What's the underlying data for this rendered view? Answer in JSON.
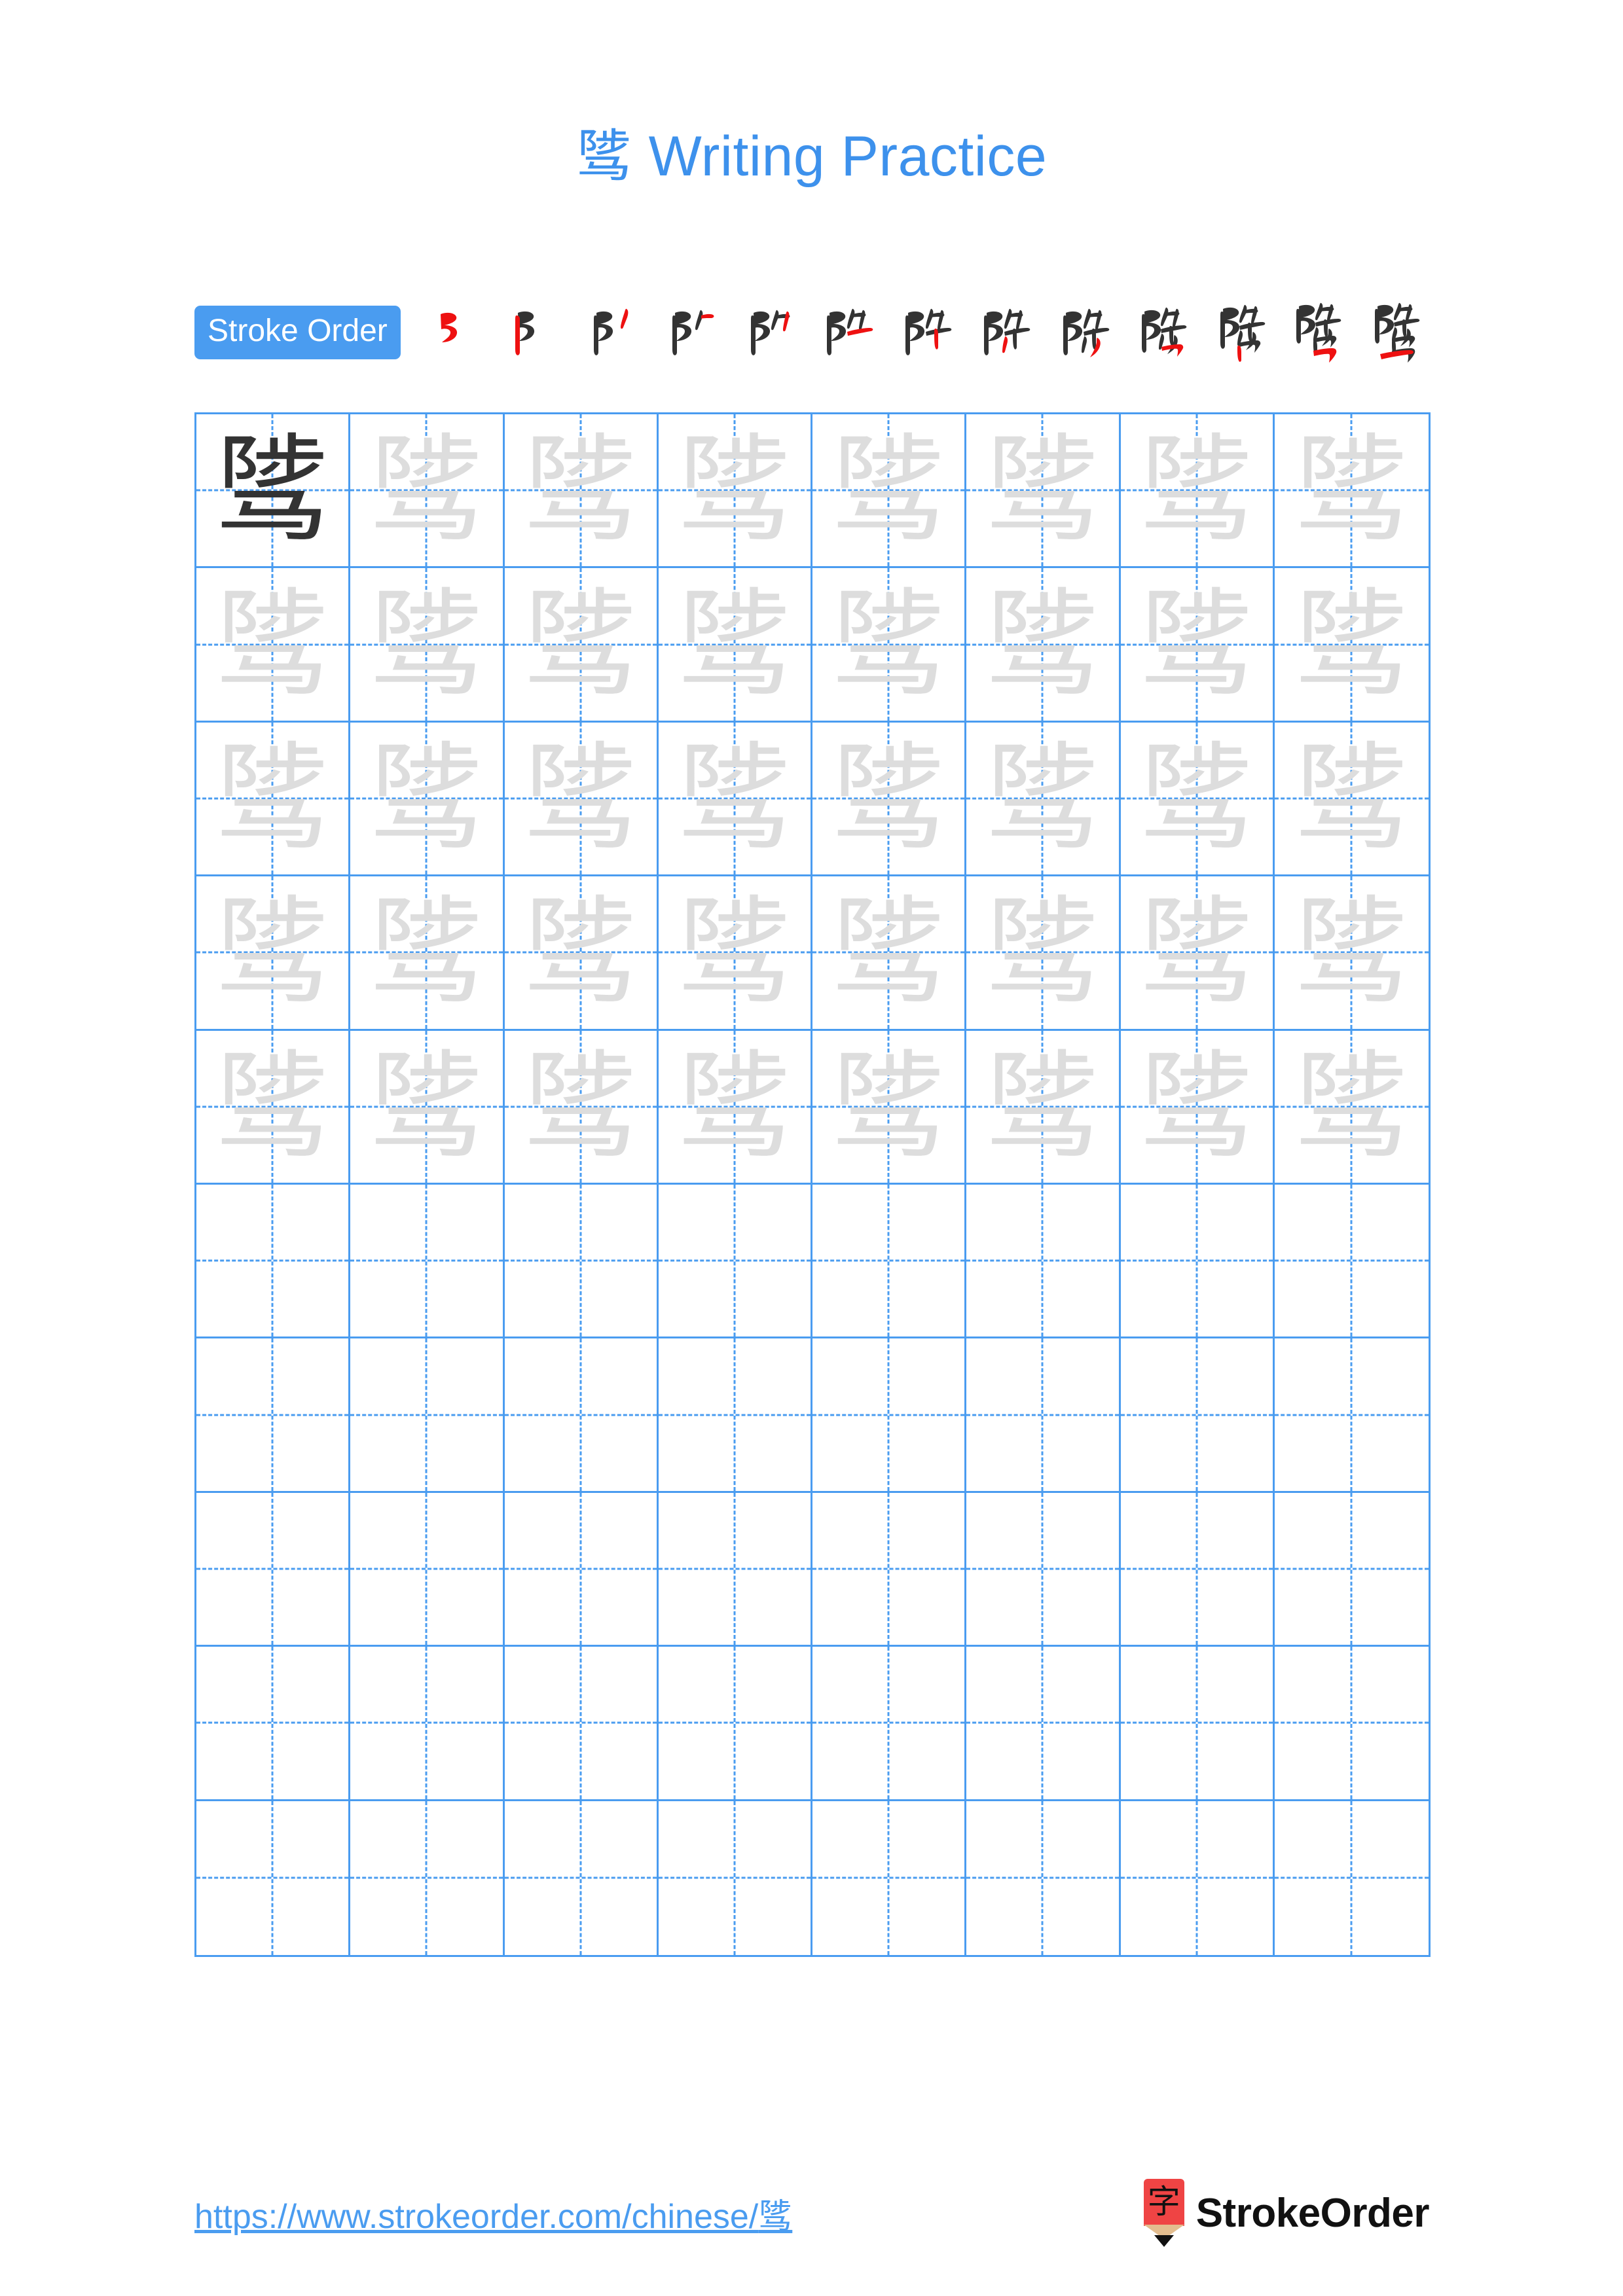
{
  "character": "骘",
  "page": {
    "title_prefix": "骘",
    "title_suffix": " Writing Practice"
  },
  "stroke_order": {
    "badge_label": "Stroke Order",
    "total_strokes": 13,
    "steps": [
      {
        "index": 1,
        "glyph": "⻖"
      },
      {
        "index": 2,
        "glyph": "阝"
      },
      {
        "index": 3,
        "glyph": "阝丿"
      },
      {
        "index": 4,
        "glyph": "阝⺊"
      },
      {
        "index": 5,
        "glyph": "阝⺊"
      },
      {
        "index": 6,
        "glyph": "阤"
      },
      {
        "index": 7,
        "glyph": "阤"
      },
      {
        "index": 8,
        "glyph": "阤"
      },
      {
        "index": 9,
        "glyph": "陟"
      },
      {
        "index": 10,
        "glyph": "陟"
      },
      {
        "index": 11,
        "glyph": "陟"
      },
      {
        "index": 12,
        "glyph": "骘"
      },
      {
        "index": 13,
        "glyph": "骘"
      }
    ]
  },
  "grid": {
    "rows": 10,
    "columns": 8,
    "filled_rows": 5,
    "cells": [
      [
        "dark",
        "ghost",
        "ghost",
        "ghost",
        "ghost",
        "ghost",
        "ghost",
        "ghost"
      ],
      [
        "ghost",
        "ghost",
        "ghost",
        "ghost",
        "ghost",
        "ghost",
        "ghost",
        "ghost"
      ],
      [
        "ghost",
        "ghost",
        "ghost",
        "ghost",
        "ghost",
        "ghost",
        "ghost",
        "ghost"
      ],
      [
        "ghost",
        "ghost",
        "ghost",
        "ghost",
        "ghost",
        "ghost",
        "ghost",
        "ghost"
      ],
      [
        "ghost",
        "ghost",
        "ghost",
        "ghost",
        "ghost",
        "ghost",
        "ghost",
        "ghost"
      ],
      [
        "empty",
        "empty",
        "empty",
        "empty",
        "empty",
        "empty",
        "empty",
        "empty"
      ],
      [
        "empty",
        "empty",
        "empty",
        "empty",
        "empty",
        "empty",
        "empty",
        "empty"
      ],
      [
        "empty",
        "empty",
        "empty",
        "empty",
        "empty",
        "empty",
        "empty",
        "empty"
      ],
      [
        "empty",
        "empty",
        "empty",
        "empty",
        "empty",
        "empty",
        "empty",
        "empty"
      ],
      [
        "empty",
        "empty",
        "empty",
        "empty",
        "empty",
        "empty",
        "empty",
        "empty"
      ]
    ]
  },
  "footer": {
    "url_text": "https://www.strokeorder.com/chinese/",
    "url_char": "骘",
    "logo_glyph": "字",
    "logo_text": "StrokeOrder"
  },
  "colors": {
    "accent_blue": "#4a9cf0",
    "title_blue": "#3d91ec",
    "ghost_gray": "#dddddd",
    "ink_dark": "#333333",
    "stroke_new_red": "#ee1111",
    "logo_red": "#ef4444",
    "logo_wood": "#e3bd8f"
  }
}
